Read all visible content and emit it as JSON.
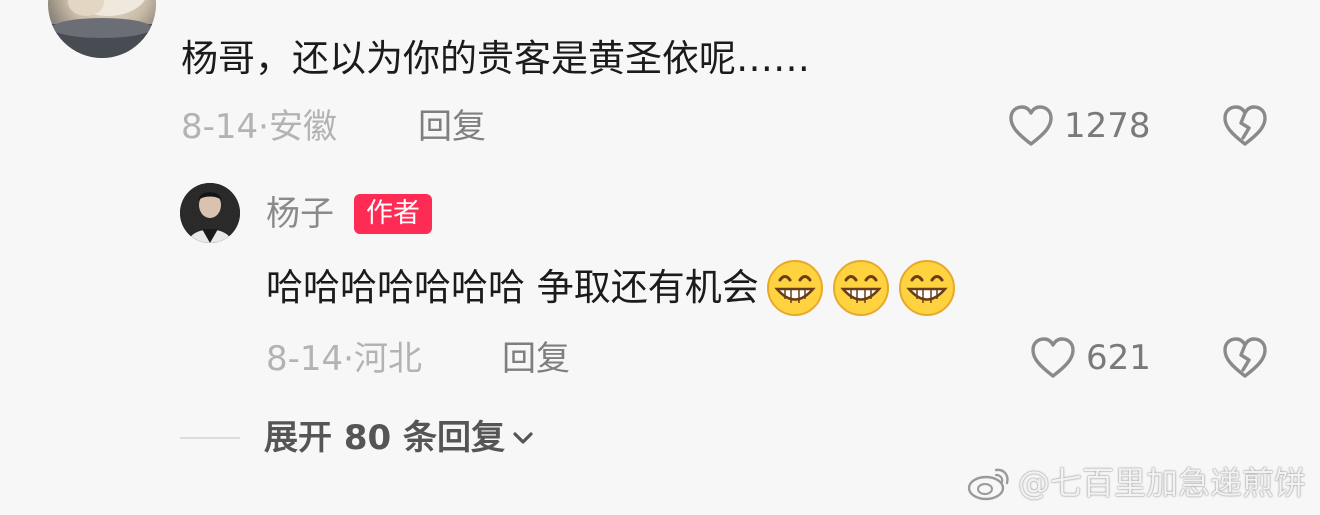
{
  "comment": {
    "text": "杨哥，还以为你的贵客是黄圣依呢……",
    "date": "8-14",
    "separator": "·",
    "location": "安徽",
    "reply_label": "回复",
    "like_count": "1278"
  },
  "reply": {
    "name": "杨子",
    "badge": "作者",
    "text": "哈哈哈哈哈哈哈 争取还有机会",
    "emojis": [
      "grin-emoji",
      "grin-emoji",
      "grin-emoji"
    ],
    "date": "8-14",
    "separator": "·",
    "location": "河北",
    "reply_label": "回复",
    "like_count": "621"
  },
  "expand": {
    "label": "展开 80 条回复"
  },
  "watermark": {
    "text": "@七百里加急递煎饼"
  },
  "colors": {
    "background": "#f7f7f7",
    "badge": "#fe2c55",
    "meta": "#b3b3b3",
    "icon": "#8a8a8a"
  }
}
